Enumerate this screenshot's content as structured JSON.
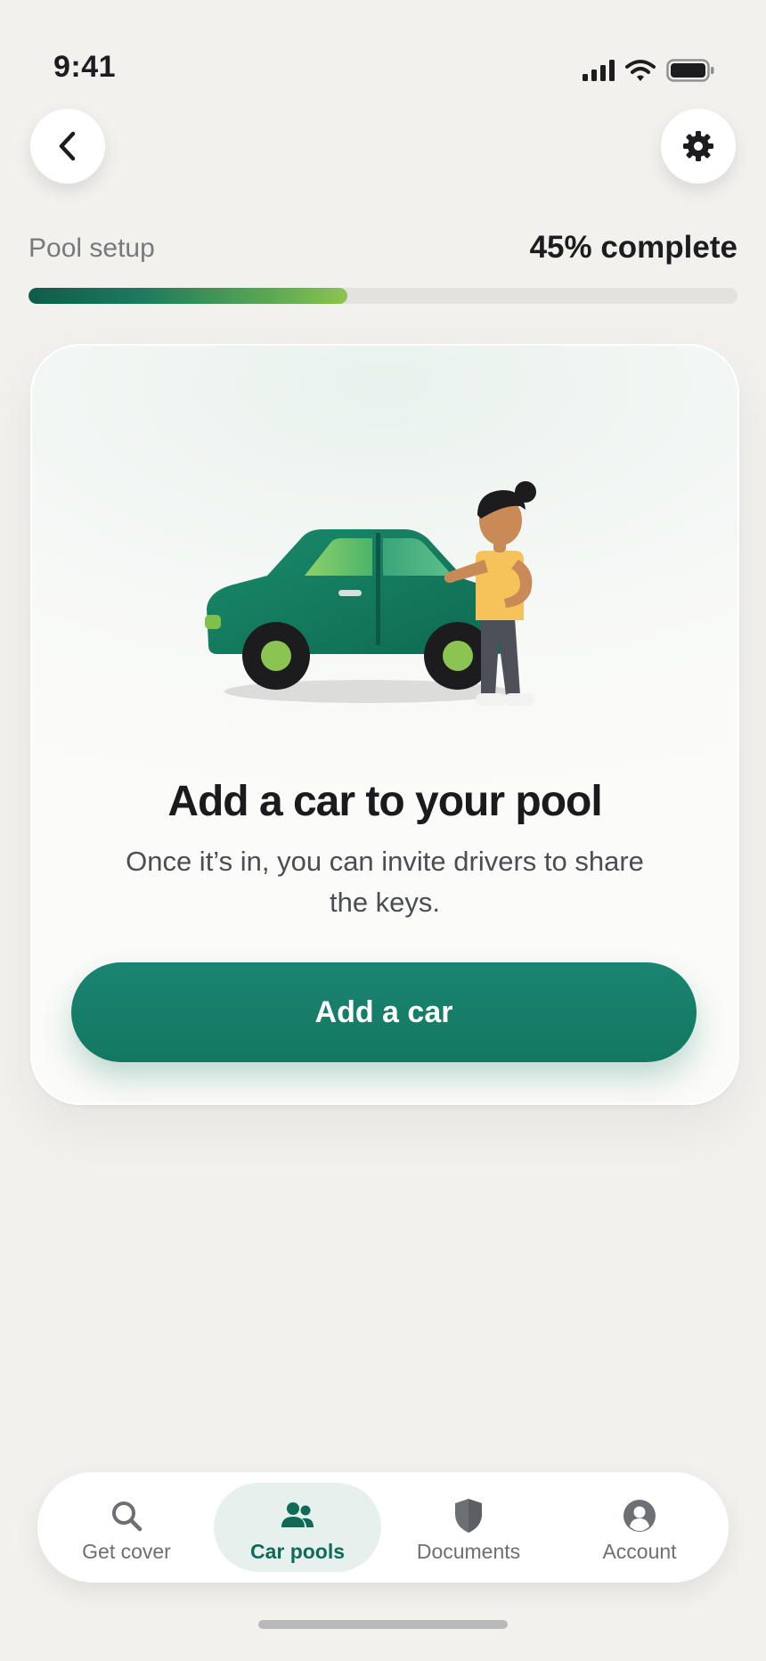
{
  "status_bar": {
    "time": "9:41"
  },
  "header": {
    "back_icon": "chevron-left-icon",
    "settings_icon": "gear-icon"
  },
  "progress": {
    "label": "Pool setup",
    "percent_text": "45% complete",
    "value": 0.45
  },
  "card": {
    "illustration": "person-standing-by-green-car",
    "title": "Add a car to your pool",
    "subtitle": "Once it’s in, you can invite drivers to share the keys.",
    "button_label": "Add a car"
  },
  "bottom_nav": {
    "items": [
      {
        "label": "Get cover",
        "icon": "search-icon",
        "active": false
      },
      {
        "label": "Car pools",
        "icon": "people-icon",
        "active": true
      },
      {
        "label": "Documents",
        "icon": "shield-icon",
        "active": false
      },
      {
        "label": "Account",
        "icon": "account-icon",
        "active": false
      }
    ]
  },
  "colors": {
    "accent": "#137861",
    "progress_end": "#8cc451",
    "background": "#f2f1ee"
  }
}
